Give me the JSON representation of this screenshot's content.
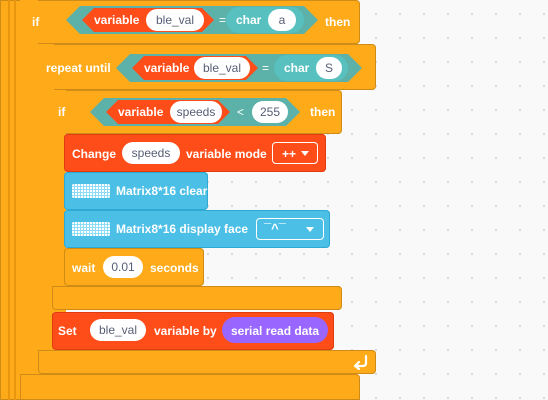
{
  "blocks": {
    "if_outer": {
      "keyword": "if",
      "then": "then",
      "condition": {
        "left_prefix": "variable",
        "left_value": "ble_val",
        "operator": "=",
        "right_prefix": "char",
        "right_value": "a"
      }
    },
    "repeat_until": {
      "keyword": "repeat until",
      "condition": {
        "left_prefix": "variable",
        "left_value": "ble_val",
        "operator": "=",
        "right_prefix": "char",
        "right_value": "S"
      }
    },
    "if_inner": {
      "keyword": "if",
      "then": "then",
      "condition": {
        "left_prefix": "variable",
        "left_value": "speeds",
        "operator": "<",
        "right_value": "255"
      }
    },
    "change_var": {
      "prefix": "Change",
      "variable": "speeds",
      "middle": "variable mode",
      "mode": "++"
    },
    "matrix_clear": {
      "label": "Matrix8*16 clear"
    },
    "matrix_face": {
      "label": "Matrix8*16 display face",
      "face": "¯^¯"
    },
    "wait": {
      "prefix": "wait",
      "value": "0.01",
      "suffix": "seconds"
    },
    "set_var": {
      "prefix": "Set",
      "variable": "ble_val",
      "middle": "variable by",
      "reporter": "serial read data"
    }
  },
  "colors": {
    "control": "#ffab19",
    "variable": "#ff4d1a",
    "operator": "#5cb1a8",
    "matrix": "#4cbfe6",
    "serial": "#9966ff"
  },
  "icons": {
    "led_matrix": "led-matrix-icon",
    "loop_arrow": "loop-arrow-icon"
  }
}
